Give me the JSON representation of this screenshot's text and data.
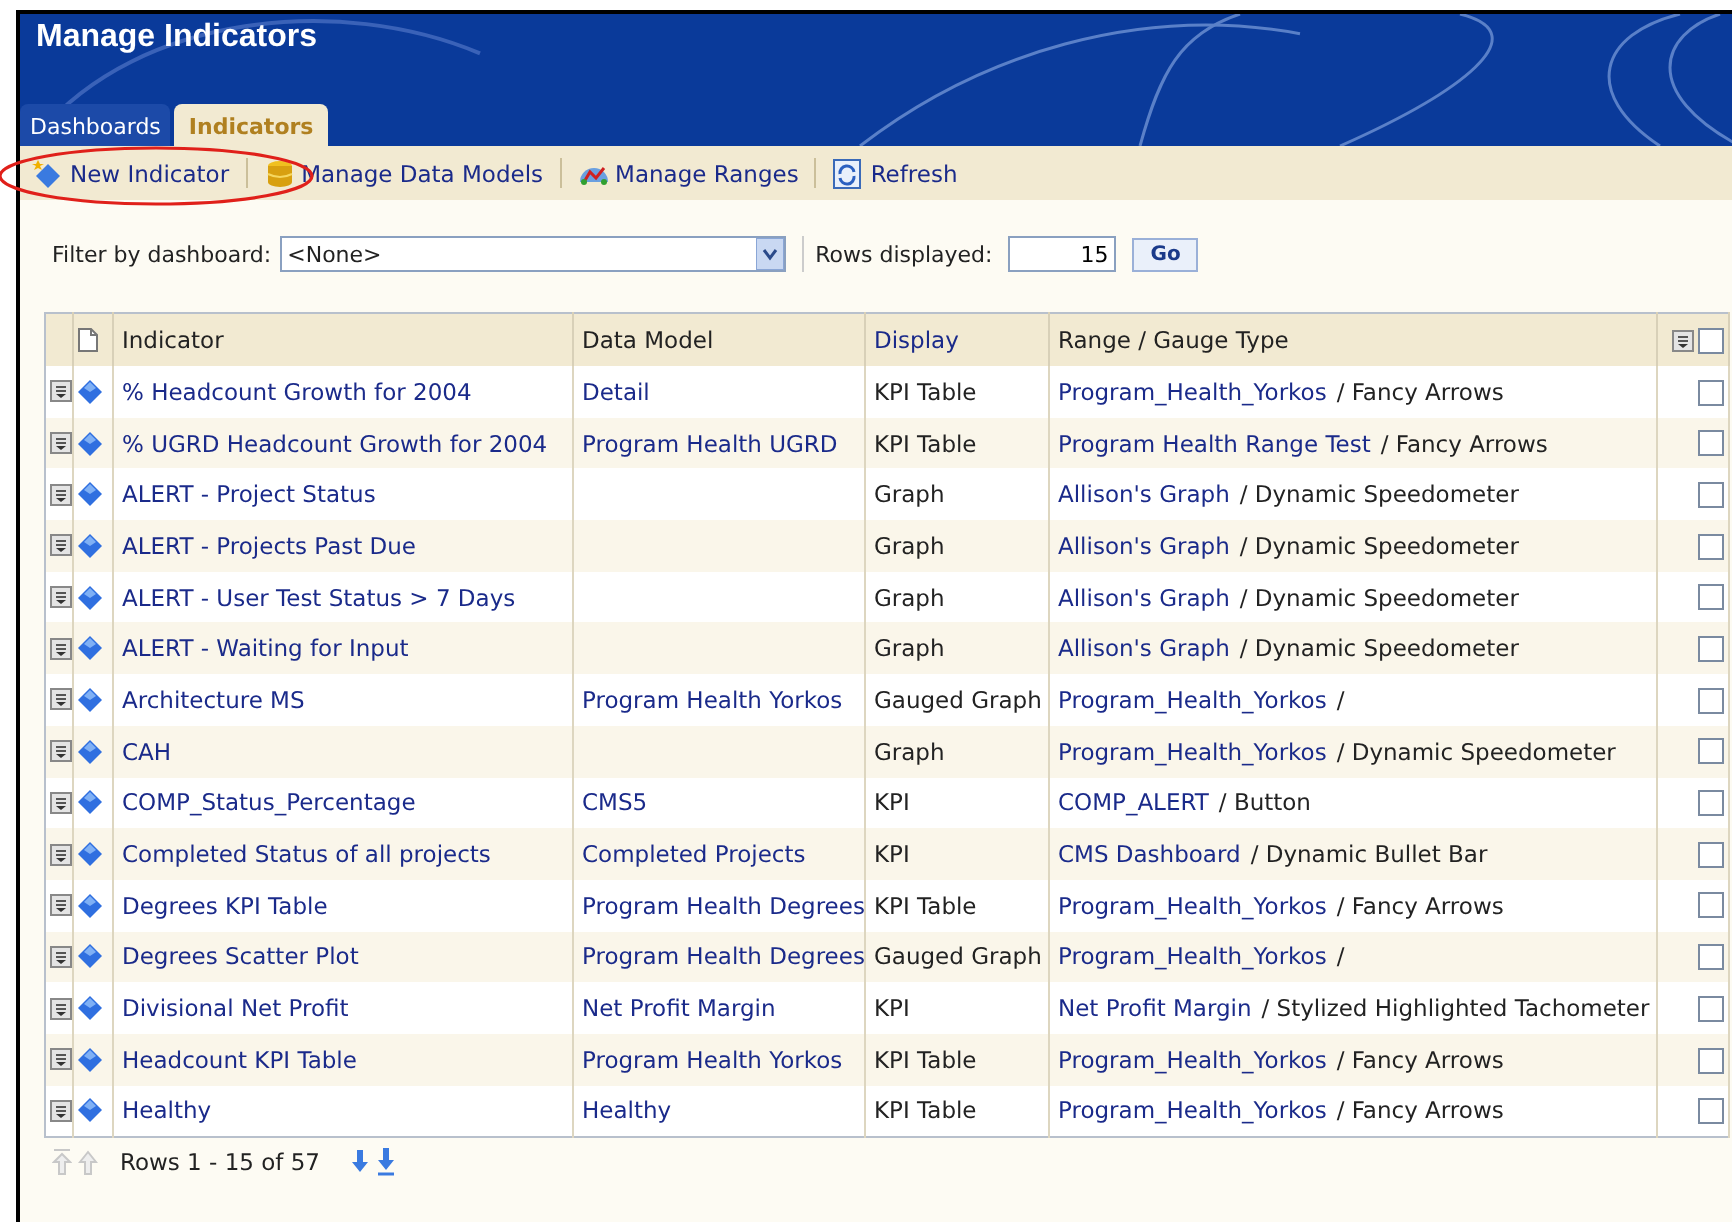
{
  "header": {
    "title": "Manage Indicators"
  },
  "tabs": [
    {
      "label": "Dashboards",
      "selected": false
    },
    {
      "label": "Indicators",
      "selected": true
    }
  ],
  "toolbar": [
    {
      "kind": "new",
      "label": "New Indicator"
    },
    {
      "kind": "models",
      "label": "Manage Data Models"
    },
    {
      "kind": "ranges",
      "label": "Manage Ranges"
    },
    {
      "kind": "refresh",
      "label": "Refresh"
    }
  ],
  "filter": {
    "label": "Filter by dashboard:",
    "value": "<None>",
    "rows_label": "Rows displayed:",
    "rows_value": "15",
    "go": "Go"
  },
  "table": {
    "columns": [
      "Indicator",
      "Data Model",
      "Display",
      "Range / Gauge Type"
    ],
    "rows": [
      {
        "indicator": "% Headcount Growth for 2004",
        "data_model": "Detail",
        "display": "KPI Table",
        "range": "Program_Health_Yorkos",
        "gauge": "/ Fancy Arrows",
        "checked": false
      },
      {
        "indicator": "% UGRD Headcount Growth for 2004",
        "data_model": "Program Health UGRD",
        "display": "KPI Table",
        "range": "Program Health Range Test",
        "gauge": "/ Fancy Arrows",
        "checked": false
      },
      {
        "indicator": "ALERT - Project Status",
        "data_model": "",
        "display": "Graph",
        "range": "Allison's Graph",
        "gauge": "/ Dynamic Speedometer",
        "checked": false
      },
      {
        "indicator": "ALERT - Projects Past Due",
        "data_model": "",
        "display": "Graph",
        "range": "Allison's Graph",
        "gauge": "/ Dynamic Speedometer",
        "checked": false
      },
      {
        "indicator": "ALERT - User Test Status > 7 Days",
        "data_model": "",
        "display": "Graph",
        "range": "Allison's Graph",
        "gauge": "/ Dynamic Speedometer",
        "checked": false
      },
      {
        "indicator": "ALERT - Waiting for Input",
        "data_model": "",
        "display": "Graph",
        "range": "Allison's Graph",
        "gauge": "/ Dynamic Speedometer",
        "checked": false
      },
      {
        "indicator": "Architecture MS",
        "data_model": "Program Health Yorkos",
        "display": "Gauged Graph",
        "range": "Program_Health_Yorkos",
        "gauge": "/",
        "checked": false
      },
      {
        "indicator": "CAH",
        "data_model": "",
        "display": "Graph",
        "range": "Program_Health_Yorkos",
        "gauge": "/ Dynamic Speedometer",
        "checked": false
      },
      {
        "indicator": "COMP_Status_Percentage",
        "data_model": "CMS5",
        "display": "KPI",
        "range": "COMP_ALERT",
        "gauge": "/ Button",
        "checked": false
      },
      {
        "indicator": "Completed Status of all projects",
        "data_model": "Completed Projects",
        "display": "KPI",
        "range": "CMS Dashboard",
        "gauge": "/ Dynamic Bullet Bar",
        "checked": false
      },
      {
        "indicator": "Degrees KPI Table",
        "data_model": "Program Health Degrees",
        "display": "KPI Table",
        "range": "Program_Health_Yorkos",
        "gauge": "/ Fancy Arrows",
        "checked": false
      },
      {
        "indicator": "Degrees Scatter Plot",
        "data_model": "Program Health Degrees",
        "display": "Gauged Graph",
        "range": "Program_Health_Yorkos",
        "gauge": "/",
        "checked": false
      },
      {
        "indicator": "Divisional Net Profit",
        "data_model": "Net Profit Margin",
        "display": "KPI",
        "range": "Net Profit Margin",
        "gauge": "/ Stylized Highlighted Tachometer",
        "checked": false
      },
      {
        "indicator": "Headcount KPI Table",
        "data_model": "Program Health Yorkos",
        "display": "KPI Table",
        "range": "Program_Health_Yorkos",
        "gauge": "/ Fancy Arrows",
        "checked": false
      },
      {
        "indicator": "Healthy",
        "data_model": "Healthy",
        "display": "KPI Table",
        "range": "Program_Health_Yorkos",
        "gauge": "/ Fancy Arrows",
        "checked": false
      }
    ],
    "select_all_checked": false
  },
  "pager": {
    "text": "Rows 1 - 15 of 57"
  }
}
